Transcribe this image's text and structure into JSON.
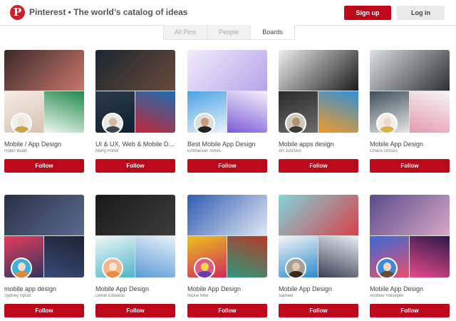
{
  "header": {
    "logo_glyph": "P",
    "title": "Pinterest • The world’s catalog of ideas",
    "signup_label": "Sign up",
    "login_label": "Log in"
  },
  "tabs": [
    {
      "label": "All Pins",
      "active": false
    },
    {
      "label": "People",
      "active": false
    },
    {
      "label": "Boards",
      "active": true
    }
  ],
  "follow_label": "Follow",
  "colors": {
    "brand": "#bd081c"
  },
  "boards": [
    {
      "title": "Mobile / App Design",
      "owner": "Robin Budd",
      "hero": [
        "#3a2a2a",
        "#c9766a"
      ],
      "left": [
        "#f4ede6",
        "#d9c2b0"
      ],
      "right": [
        "#1f8a4d",
        "#f2f7f1"
      ],
      "avatar": [
        "#f5e4d4",
        "#c9a24b",
        "#f2efe9"
      ]
    },
    {
      "title": "UI & UX, Web & Mobile Design",
      "owner": "Marty Porter",
      "hero": [
        "#1a2630",
        "#6a4a3a"
      ],
      "left": [
        "#2b3b4c",
        "#0f2030"
      ],
      "right": [
        "#1b6fb0",
        "#c2263a"
      ],
      "avatar": [
        "#d8b79d",
        "#3d4650",
        "#e9e9ea"
      ]
    },
    {
      "title": "Best Mobile App Design",
      "owner": "Emmanuel Torres",
      "hero": [
        "#f2ecfb",
        "#b7a3ea"
      ],
      "left": [
        "#4aa3e2",
        "#e9f2fb"
      ],
      "right": [
        "#f6f1fb",
        "#7b5ad8"
      ],
      "avatar": [
        "#c79a7a",
        "#222222",
        "#dedede"
      ]
    },
    {
      "title": "Mobile apps design",
      "owner": "Art Junction",
      "hero": [
        "#eeeeee",
        "#1b1b1b"
      ],
      "left": [
        "#2a2a2a",
        "#6b6b6b"
      ],
      "right": [
        "#2f8fd8",
        "#f19a2a"
      ],
      "avatar": [
        "#b5916f",
        "#3b3b3b",
        "#cfc9c2"
      ]
    },
    {
      "title": "Mobile App Design",
      "owner": "Chiara Grosso",
      "hero": [
        "#dcdfe6",
        "#2d2f33"
      ],
      "left": [
        "#3d4f5c",
        "#e6e6e6"
      ],
      "right": [
        "#f6f6f6",
        "#e59ab0"
      ],
      "avatar": [
        "#f1d9c6",
        "#d9b44b",
        "#f2efe8"
      ]
    },
    {
      "title": "mobile app design",
      "owner": "Sydney Spratt",
      "hero": [
        "#2a3147",
        "#5a6a8e"
      ],
      "left": [
        "#e63b5a",
        "#2f3560"
      ],
      "right": [
        "#1d2334",
        "#3a4a78"
      ],
      "avatar": [
        "#f3dcc8",
        "#d98a3b",
        "#3ab0e0"
      ]
    },
    {
      "title": "Mobile App Design",
      "owner": "Derrin Edwards",
      "hero": [
        "#1a1a1a",
        "#3b3b3b"
      ],
      "left": [
        "#f2f6f8",
        "#4bb6c8"
      ],
      "right": [
        "#e9f1f8",
        "#5a9ad8"
      ],
      "avatar": [
        "#f4e6d8",
        "#e88a4a",
        "#f7b58a"
      ]
    },
    {
      "title": "Mobile App Design",
      "owner": "Nickie Mee",
      "hero": [
        "#2f5bb0",
        "#dfe8f5"
      ],
      "left": [
        "#ecc21a",
        "#d02a5a"
      ],
      "right": [
        "#b83a2a",
        "#2a9a7a"
      ],
      "avatar": [
        "#f7d64b",
        "#6a3ab0",
        "#e25a8a"
      ]
    },
    {
      "title": "Mobile App Design",
      "owner": "Sameer",
      "hero": [
        "#7fd6da",
        "#d8404a"
      ],
      "left": [
        "#f6f6f6",
        "#2a8ad0"
      ],
      "right": [
        "#e8eef2",
        "#3a3f52"
      ],
      "avatar": [
        "#e6c8a8",
        "#3b2a1a",
        "#a0a0a0"
      ]
    },
    {
      "title": "Mobile App Design",
      "owner": "Andrew Yeliseyev",
      "hero": [
        "#5a4a8a",
        "#d8a8c8"
      ],
      "left": [
        "#3a6ad8",
        "#e8506a"
      ],
      "right": [
        "#2a1a4a",
        "#e84a8a"
      ],
      "avatar": [
        "#f2d8c2",
        "#6a4a3a",
        "#3a8ad8"
      ]
    }
  ]
}
